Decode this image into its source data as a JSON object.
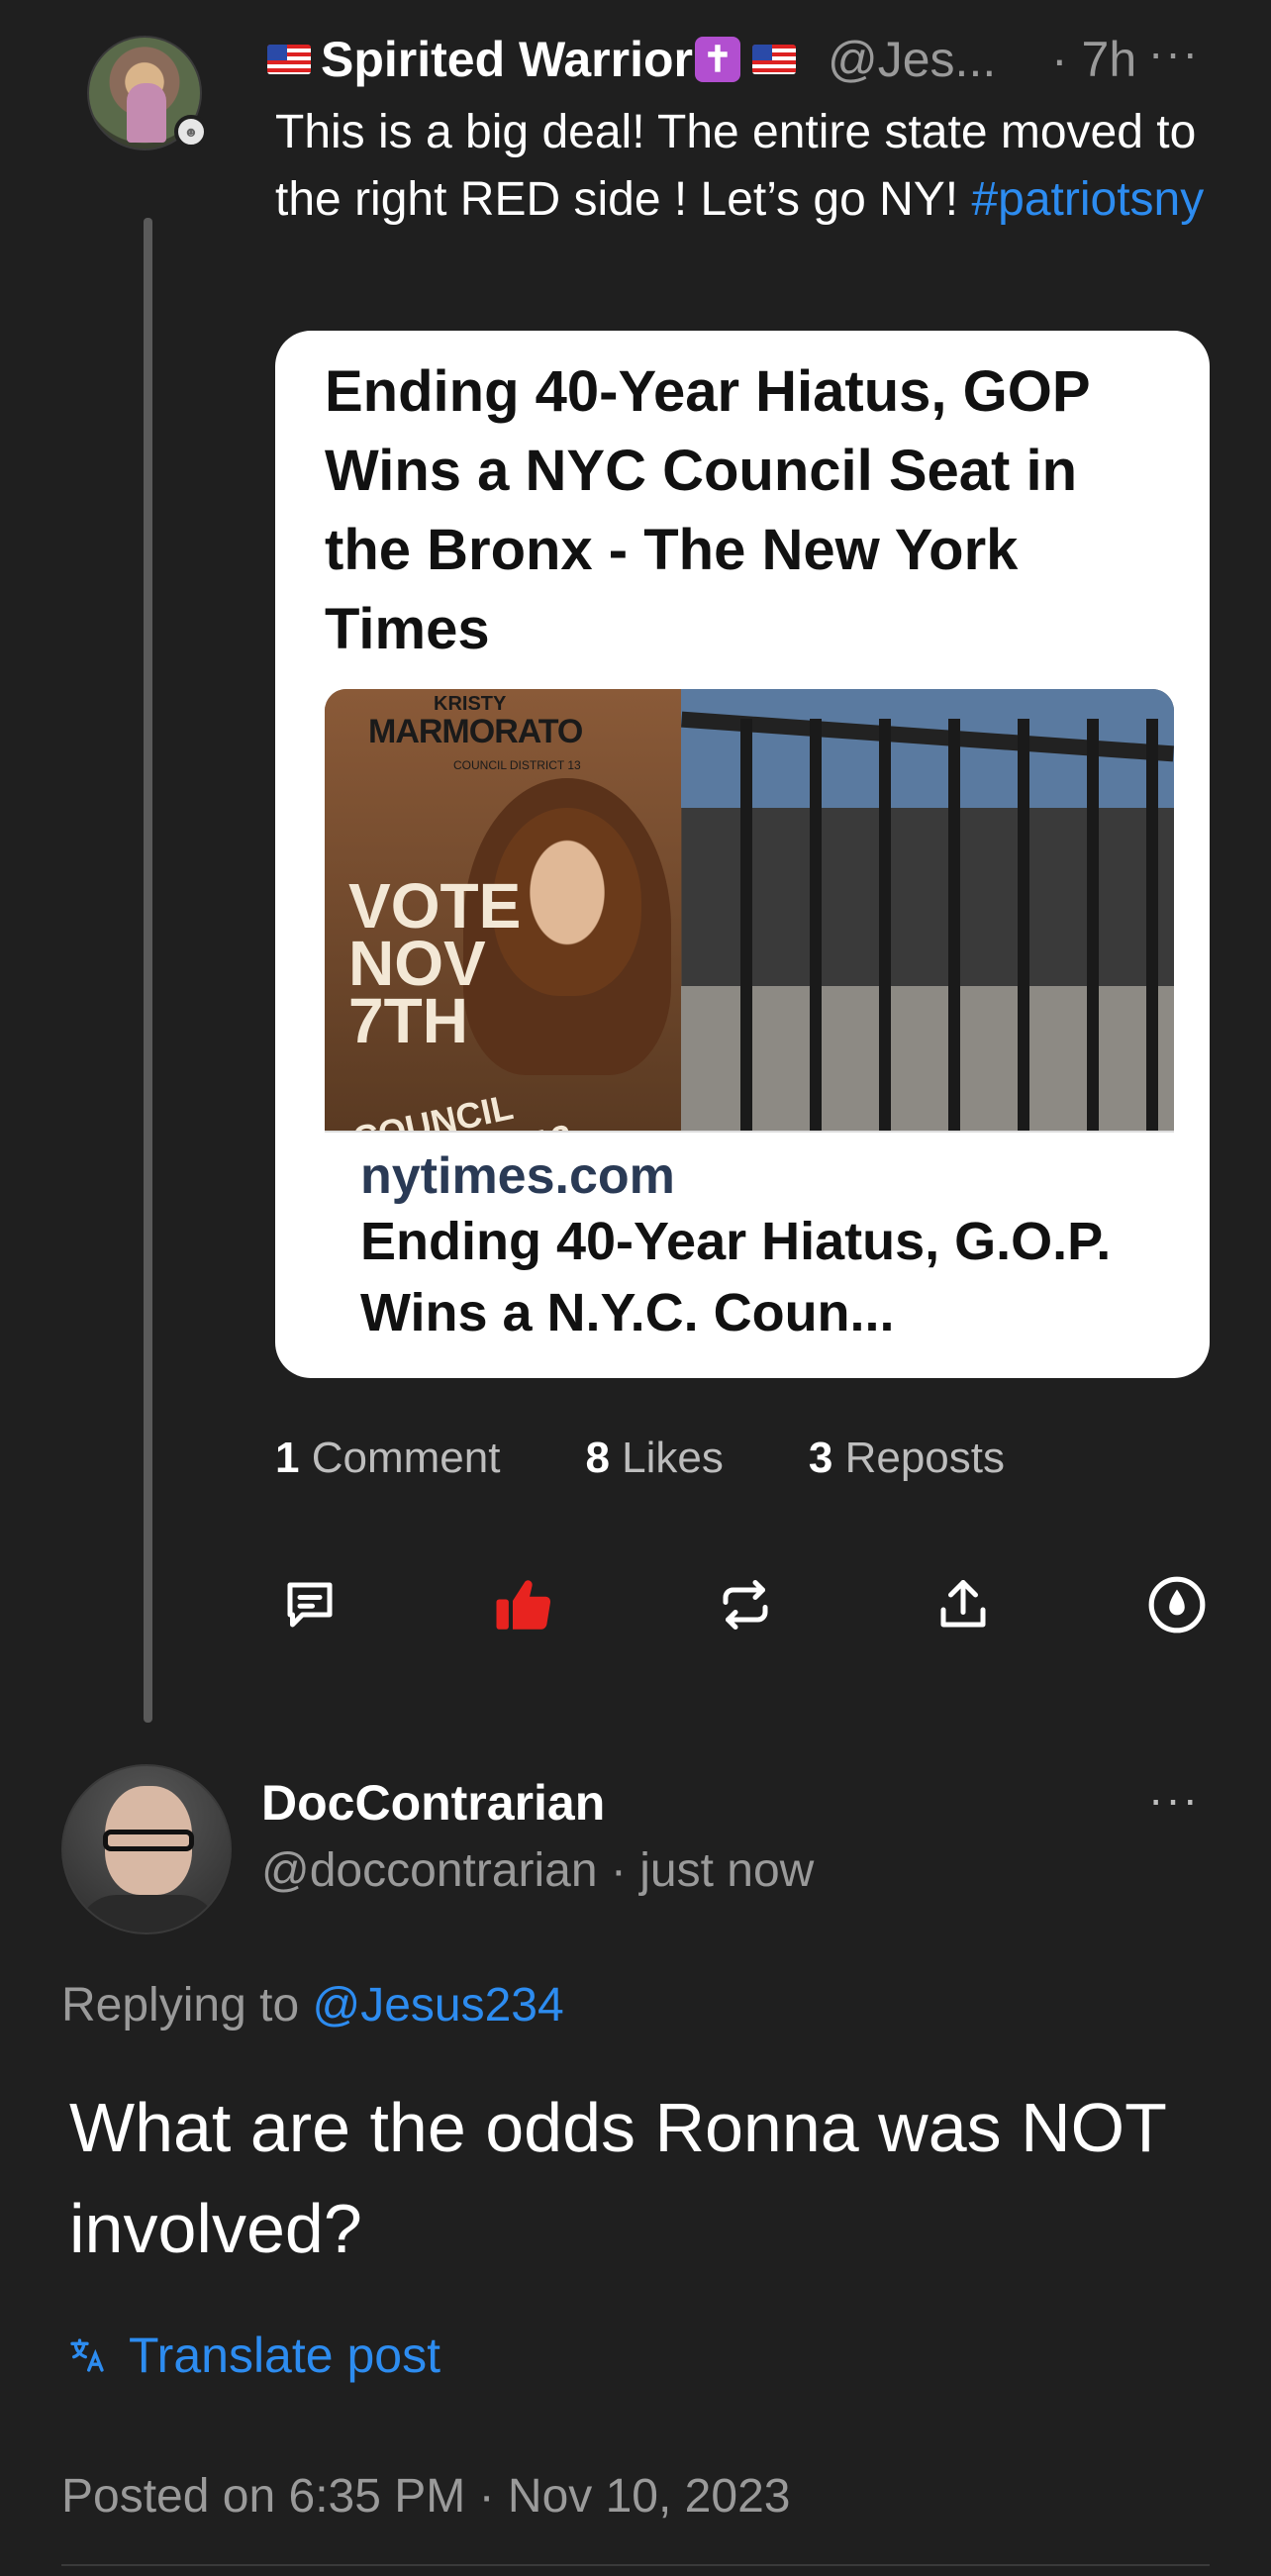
{
  "parent_post": {
    "author": "Spirited Warrior",
    "handle": "@Jes...",
    "time": "· 7h",
    "more": "···",
    "text_main": "This is a big deal!  The entire state moved to the right RED side !  Let’s go NY! ",
    "hashtag": "#patriotsny",
    "link_card": {
      "headline": "Ending 40-Year Hiatus, GOP Wins a NYC Council Seat in the Bronx - The New York Times",
      "image": {
        "poster_small": "KRISTY",
        "poster_name": "MARMORATO",
        "poster_sub": "COUNCIL DISTRICT 13",
        "poster_vote": "VOTE NOV 7TH",
        "poster_district": "COUNCIL DISTRICT 13"
      },
      "domain": "nytimes.com",
      "title": "Ending 40-Year Hiatus, G.O.P. Wins a N.Y.C. Coun..."
    },
    "stats": {
      "comments_count": "1",
      "comments_label": " Comment",
      "likes_count": "8",
      "likes_label": " Likes",
      "reposts_count": "3",
      "reposts_label": " Reposts"
    },
    "actions": [
      {
        "icon": "comment-icon"
      },
      {
        "icon": "thumbs-up-icon",
        "active": true,
        "color": "#e8231f"
      },
      {
        "icon": "repost-icon"
      },
      {
        "icon": "share-icon"
      },
      {
        "icon": "bookmark-icon"
      }
    ]
  },
  "reply": {
    "author": "DocContrarian",
    "handle": "@doccontrarian · just now",
    "more": "···",
    "replying_prefix": "Replying to ",
    "replying_to": "@Jesus234",
    "text": "What are the odds Ronna was NOT involved?",
    "translate_label": "Translate post",
    "posted": "Posted on 6:35 PM · Nov 10, 2023"
  },
  "colors": {
    "background": "#1f1f1f",
    "link": "#2d8cf0",
    "muted": "#9a9a9a",
    "like_active": "#e8231f"
  }
}
